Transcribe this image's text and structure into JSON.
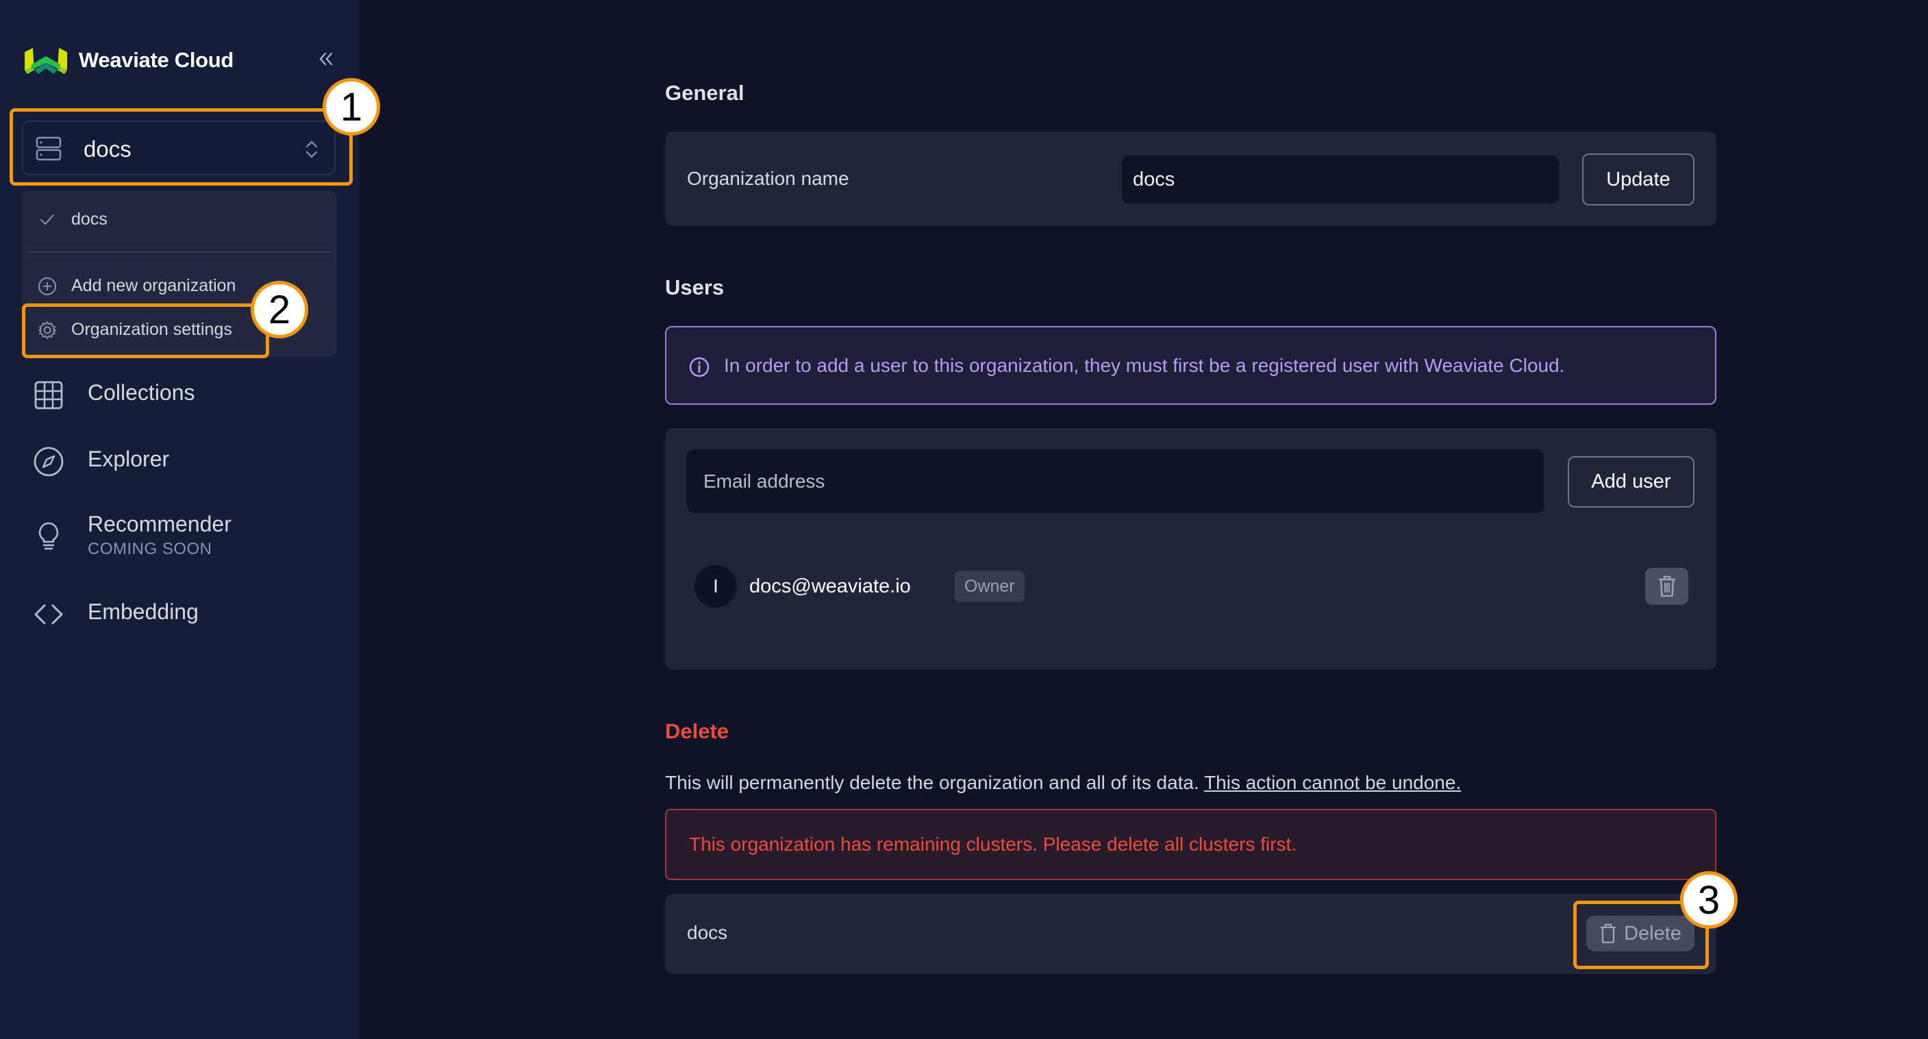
{
  "app": {
    "brand": "Weaviate Cloud",
    "logo_colors": [
      "#d6e000",
      "#7bc62e",
      "#1ea34a",
      "#0d6e5e"
    ]
  },
  "sidebar": {
    "collapse_icon": "chevrons-left-icon",
    "org_selector": {
      "value": "docs",
      "icon": "server-icon",
      "toggle_icon": "chevron-up-down-icon"
    },
    "org_dropdown": {
      "orgs": [
        {
          "label": "docs",
          "selected": true,
          "icon": "check-icon"
        }
      ],
      "actions": [
        {
          "label": "Add new organization",
          "icon": "plus-circle-icon"
        },
        {
          "label": "Organization settings",
          "icon": "gear-icon"
        }
      ]
    },
    "nav": [
      {
        "label": "Collections",
        "icon": "table-icon"
      },
      {
        "label": "Explorer",
        "icon": "compass-icon"
      },
      {
        "label": "Recommender",
        "sublabel": "COMING SOON",
        "icon": "lightbulb-icon"
      },
      {
        "label": "Embedding",
        "icon": "code-brackets-icon"
      }
    ]
  },
  "general": {
    "heading": "General",
    "org_name_label": "Organization name",
    "org_name_value": "docs",
    "update_label": "Update"
  },
  "users": {
    "heading": "Users",
    "info": "In order to add a user to this organization, they must first be a registered user with Weaviate Cloud.",
    "email_placeholder": "Email address",
    "email_value": "",
    "add_user_label": "Add user",
    "list": [
      {
        "avatar_initial": "I",
        "email": "docs@weaviate.io",
        "role": "Owner"
      }
    ]
  },
  "delete": {
    "heading": "Delete",
    "description": "This will permanently delete the organization and all of its data.",
    "warning_link": "This action cannot be undone.",
    "error": "This organization has remaining clusters. Please delete all clusters first.",
    "org_name": "docs",
    "delete_label": "Delete"
  },
  "annotations": {
    "markers": [
      "1",
      "2",
      "3"
    ],
    "highlight_color": "#f7960e"
  },
  "colors": {
    "sidebar_bg": "#141e38",
    "main_bg": "#0e1426",
    "card_bg": "#1f2639",
    "info_accent": "#b89af0",
    "danger": "#ef4a3c"
  }
}
